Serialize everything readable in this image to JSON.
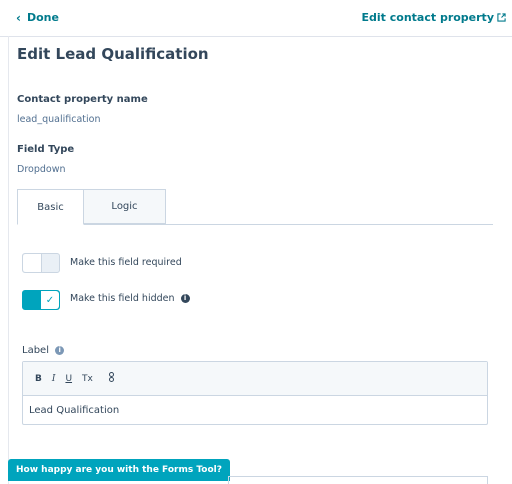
{
  "header": {
    "done_label": "Done",
    "edit_link_label": "Edit contact property"
  },
  "title": "Edit Lead Qualification",
  "property": {
    "name_label": "Contact property name",
    "name_value": "lead_qualification",
    "type_label": "Field Type",
    "type_value": "Dropdown"
  },
  "tabs": [
    {
      "label": "Basic",
      "active": true
    },
    {
      "label": "Logic",
      "active": false
    }
  ],
  "options": {
    "required_label": "Make this field required",
    "required_on": false,
    "hidden_label": "Make this field hidden",
    "hidden_on": true
  },
  "label_field": {
    "title": "Label",
    "toolbar": [
      "B",
      "I",
      "U",
      "Tx",
      "link"
    ],
    "value": "Lead Qualification"
  },
  "feedback_label": "How happy are you with the Forms Tool?",
  "colors": {
    "accent": "#00a4bd",
    "link": "#007a8c",
    "text": "#33475b"
  }
}
